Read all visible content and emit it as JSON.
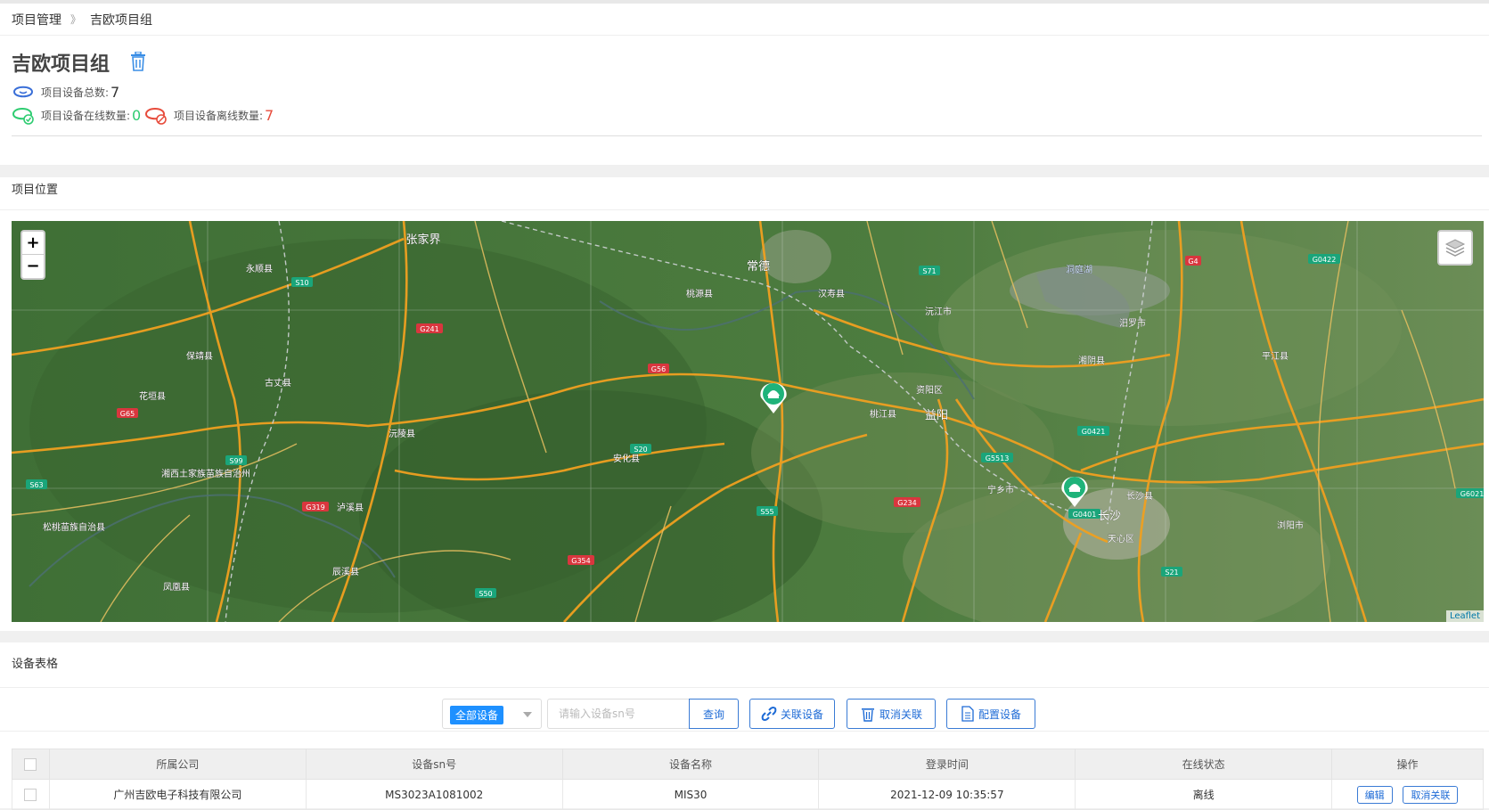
{
  "breadcrumb": {
    "root": "项目管理",
    "separator": "》",
    "current": "吉欧项目组"
  },
  "project": {
    "title": "吉欧项目组"
  },
  "stats": {
    "total_label": "项目设备总数:",
    "total": "7",
    "online_label": "项目设备在线数量:",
    "online": "0",
    "offline_label": "项目设备离线数量:",
    "offline": "7"
  },
  "map_section": {
    "title": "项目位置",
    "zoom_in": "+",
    "zoom_out": "−",
    "attribution": "Leaflet",
    "labels": [
      "张家界",
      "常德",
      "桃源县",
      "汉寿县",
      "沅江市",
      "湘阴县",
      "汨罗市",
      "平江县",
      "保靖县",
      "古丈县",
      "花垣县",
      "沅陵县",
      "安化县",
      "桃江县",
      "益阳",
      "资阳区",
      "宁乡市",
      "长沙县",
      "长沙",
      "天心区",
      "浏阳市",
      "泸溪县",
      "辰溪县",
      "凤凰县",
      "湘西土家族苗族自治州",
      "松桃苗族自治县",
      "永顺县",
      "洞庭湖"
    ],
    "roads": [
      "S10",
      "G241",
      "G56",
      "G65",
      "S99",
      "G319",
      "S63",
      "S20",
      "G5513",
      "S71",
      "G4",
      "G0422",
      "G0421",
      "G0401",
      "G234",
      "G354",
      "S50",
      "S55",
      "S21",
      "G6021"
    ]
  },
  "device_section": {
    "title": "设备表格",
    "filter_selected": "全部设备",
    "search_placeholder": "请输入设备sn号",
    "query_label": "查询",
    "link_label": "关联设备",
    "unlink_label": "取消关联",
    "config_label": "配置设备",
    "columns": [
      "所属公司",
      "设备sn号",
      "设备名称",
      "登录时间",
      "在线状态",
      "操作"
    ],
    "rows": [
      {
        "company": "广州吉欧电子科技有限公司",
        "sn": "MS3023A1081002",
        "name": "MIS30",
        "login_time": "2021-12-09 10:35:57",
        "status": "离线",
        "edit": "编辑",
        "unlink": "取消关联"
      }
    ]
  },
  "colors": {
    "accent": "#1e6bd6",
    "online": "#2ecc71",
    "offline": "#e74c3c",
    "marker": "#1fb37a"
  }
}
